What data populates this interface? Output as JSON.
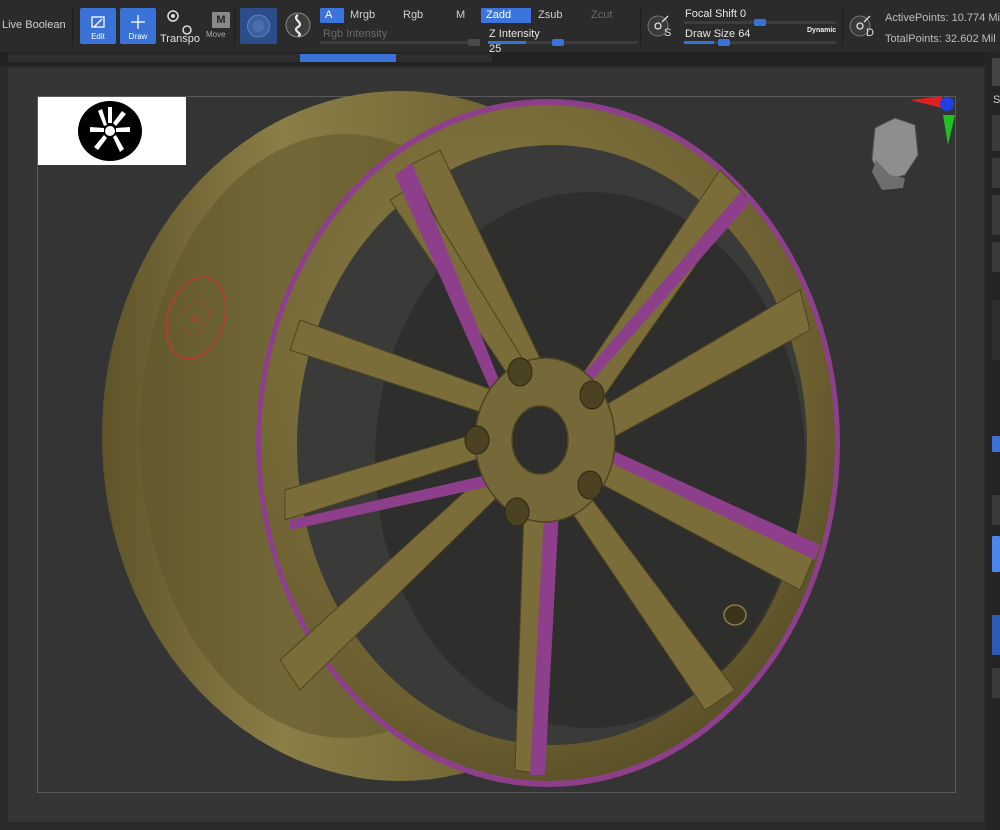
{
  "toolbar": {
    "live_boolean": "Live Boolean",
    "edit_label": "Edit",
    "draw_label": "Draw",
    "transpose_label": "Transpo",
    "move_label": "Move",
    "move_badge": "M",
    "rgb_group": {
      "a_label": "A",
      "mrgb_label": "Mrgb",
      "rgb_label": "Rgb",
      "m_label": "M",
      "rgb_intensity_label": "Rgb Intensity"
    },
    "z_group": {
      "zadd_label": "Zadd",
      "zsub_label": "Zsub",
      "zcut_label": "Zcut",
      "z_intensity_label": "Z Intensity",
      "z_intensity_value": "25",
      "z_intensity_level": 0.25
    },
    "focal": {
      "label": "Focal Shift",
      "value": "0",
      "level": 0.5
    },
    "draw_size": {
      "label": "Draw Size",
      "value": "64",
      "dynamic_label": "Dynamic",
      "level": 0.2
    },
    "s_badge": "S",
    "d_badge": "D",
    "active_points": "ActivePoints: 10.774 Mil",
    "total_points": "TotalPoints: 32.602 Mil"
  },
  "right_panel": {
    "s_label": "S"
  },
  "colors": {
    "accent": "#3a72d8",
    "model_base": "#6e6233",
    "polypaint": "#8d3f8b",
    "brush_ring": "#c23a2a"
  }
}
